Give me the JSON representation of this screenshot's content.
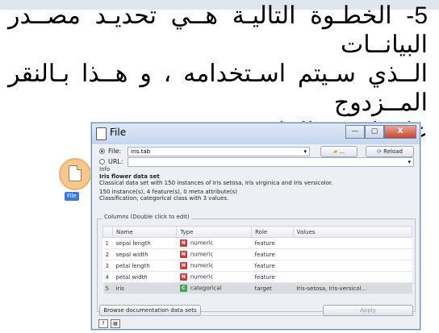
{
  "heading": {
    "line1": "5- الخطـوة التاليـة هــي تحديـد مصــدر البيانــات",
    "line2": "الــذي سـيتم اسـتخدامه ، و هــذا بـالنقر المــزدوج",
    "line3": "على ايقونه الملف"
  },
  "canvas": {
    "widget_label": "File"
  },
  "window": {
    "title": "File",
    "controls": {
      "minimize": "—",
      "maximize": "▢",
      "close": "X"
    }
  },
  "source": {
    "file_label": "File:",
    "file_value": "iris.tab",
    "browse_label": "...",
    "reload_label": "Reload",
    "url_label": "URL:",
    "url_value": ""
  },
  "info": {
    "legend": "Info",
    "dataset_title": "Iris flower data set",
    "dataset_desc": "Classical data set with 150 instances of Iris setosa, Iris virginica and Iris versicolor.",
    "stats_line": "150 instance(s), 4 feature(s), 0 meta attribute(s)",
    "class_line": "Classification; categorical class with 3 values."
  },
  "columns": {
    "legend": "Columns (Double click to edit)",
    "headers": [
      "Name",
      "Type",
      "Role",
      "Values"
    ],
    "rows": [
      {
        "idx": "1",
        "name": "sepal length",
        "type_code": "N",
        "type": "numeric",
        "role": "feature",
        "values": ""
      },
      {
        "idx": "2",
        "name": "sepal width",
        "type_code": "N",
        "type": "numeric",
        "role": "feature",
        "values": ""
      },
      {
        "idx": "3",
        "name": "petal length",
        "type_code": "N",
        "type": "numeric",
        "role": "feature",
        "values": ""
      },
      {
        "idx": "4",
        "name": "petal width",
        "type_code": "N",
        "type": "numeric",
        "role": "feature",
        "values": ""
      },
      {
        "idx": "5",
        "name": "iris",
        "type_code": "C",
        "type": "categorical",
        "role": "target",
        "values": "Iris-setosa, Iris-versicol..."
      }
    ]
  },
  "footer": {
    "browse_docs_label": "Browse documentation data sets",
    "apply_label": "Apply",
    "help_icon": "?",
    "report_icon": "▤"
  },
  "colors": {
    "numeric_badge": "#d0353b",
    "categorical_badge": "#3aa55a",
    "canvas_widget": "#f6c791"
  }
}
